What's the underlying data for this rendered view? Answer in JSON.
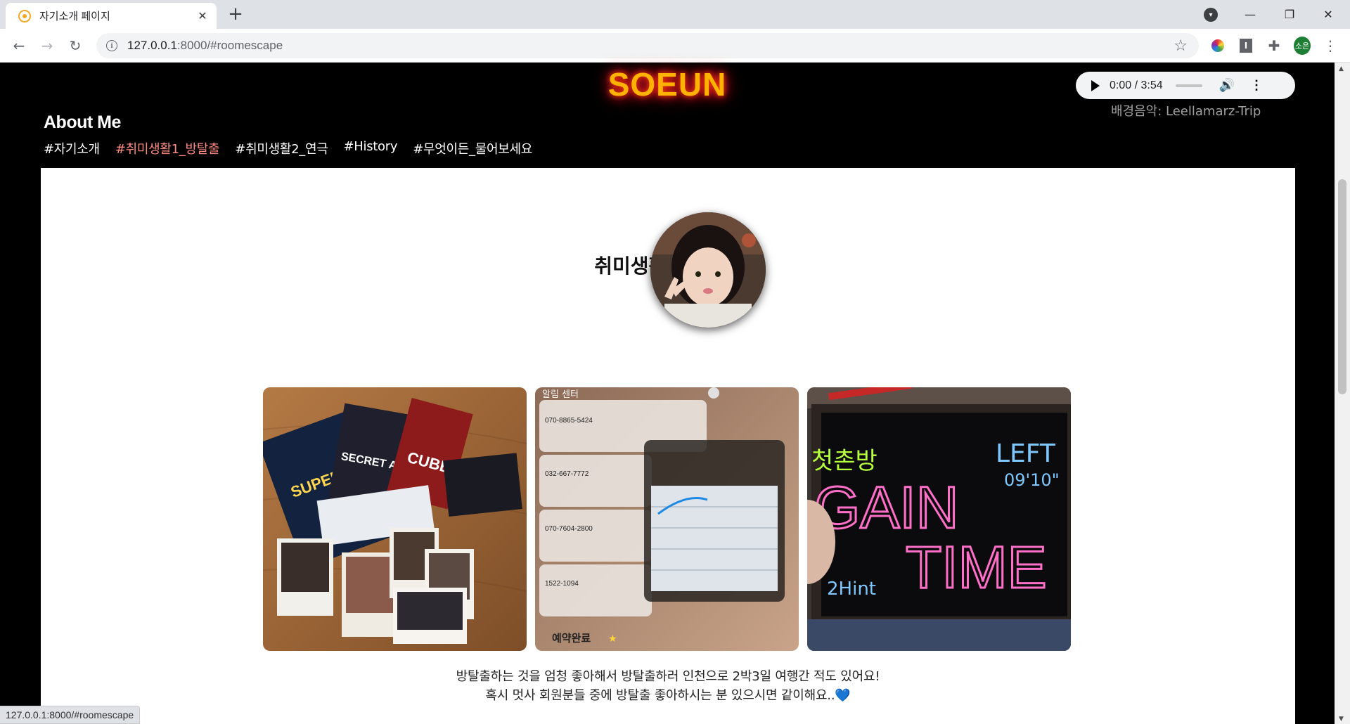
{
  "browser": {
    "tab_title": "자기소개 페이지",
    "close_glyph": "✕",
    "new_tab_glyph": "+",
    "url_host": "127.0.0.1",
    "url_path": ":8000/#roomescape",
    "profile_initials": "소은",
    "status_url": "127.0.0.1:8000/#roomescape"
  },
  "header": {
    "brand": "SOEUN",
    "about_title": "About Me",
    "nav": [
      {
        "label": "#자기소개",
        "active": false
      },
      {
        "label": "#취미생활1_방탈출",
        "active": true
      },
      {
        "label": "#취미생활2_연극",
        "active": false
      },
      {
        "label": "#History",
        "active": false
      },
      {
        "label": "#무엇이든_물어보세요",
        "active": false
      }
    ]
  },
  "audio": {
    "time": "0:00 / 3:54",
    "volume_fraction": 0.0,
    "bgm_caption": "배경음악: Leellamarz-Trip"
  },
  "section": {
    "title": "취미생활1 방탈출",
    "photos": [
      {
        "name": "escape-room-tickets-photo",
        "texts": [
          "SUPER PLAYER",
          "SECRET ADVENTURE",
          "CUBE"
        ]
      },
      {
        "name": "reservation-notifications-photo",
        "texts": [
          "알림 센터",
          "070-8865-5424",
          "032-667-7772",
          "070-7604-2800",
          "1522-1094",
          "예약완료"
        ]
      },
      {
        "name": "gain-time-board-photo",
        "texts": [
          "첫촌방",
          "LEFT",
          "09'10\"",
          "GAIN",
          "TIME",
          "2Hint"
        ]
      }
    ],
    "description": [
      "방탈출하는 것을 엄청 좋아해서 방탈출하러 인천으로 2박3일 여행간 적도 있어요!",
      "혹시 멋사 회원분들 중에 방탈출 좋아하시는 분 있으시면 같이해요..💙"
    ]
  },
  "colors": {
    "brand": "#ffb300",
    "brand_glow": "#ff1744",
    "nav_active": "#ff8a80",
    "page_bg": "#000000",
    "content_bg": "#ffffff"
  }
}
